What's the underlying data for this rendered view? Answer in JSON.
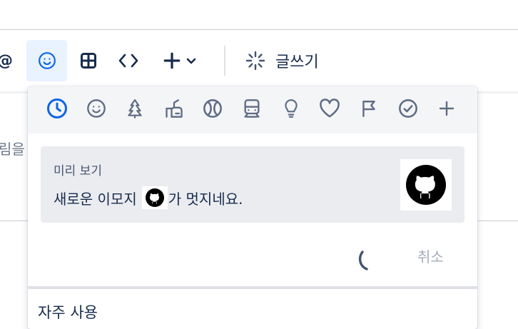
{
  "toolbar": {
    "mention_label": "@",
    "write_label": "글쓰기",
    "emoji_button_active": true,
    "accent_color": "#0c66e4",
    "icons": [
      "mention-icon",
      "emoji-icon",
      "table-icon",
      "code-icon",
      "plus-icon",
      "chevron-down-icon",
      "sparkle-icon"
    ]
  },
  "background": {
    "partial_text": "림을"
  },
  "emoji_picker": {
    "categories": [
      {
        "name": "recent",
        "icon": "clock-icon",
        "active": true
      },
      {
        "name": "people",
        "icon": "smiley-icon",
        "active": false
      },
      {
        "name": "nature",
        "icon": "tree-icon",
        "active": false
      },
      {
        "name": "food",
        "icon": "food-icon",
        "active": false
      },
      {
        "name": "activity",
        "icon": "ball-icon",
        "active": false
      },
      {
        "name": "travel",
        "icon": "train-icon",
        "active": false
      },
      {
        "name": "objects",
        "icon": "lightbulb-icon",
        "active": false
      },
      {
        "name": "symbols",
        "icon": "heart-icon",
        "active": false
      },
      {
        "name": "flags",
        "icon": "flag-icon",
        "active": false
      },
      {
        "name": "productivity",
        "icon": "check-circle-icon",
        "active": false
      },
      {
        "name": "add-custom",
        "icon": "plus-icon",
        "active": false
      }
    ],
    "preview": {
      "label": "미리 보기",
      "text_before": "새로운 이모지",
      "text_after": "가 멋지네요.",
      "emoji_icon": "github-icon"
    },
    "cancel_label": "취소",
    "frequent_title": "자주 사용"
  }
}
